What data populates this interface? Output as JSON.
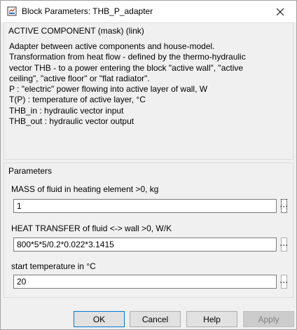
{
  "window": {
    "title": "Block Parameters: THB_P_adapter"
  },
  "description_group": {
    "title": "ACTIVE COMPONENT (mask) (link)",
    "text": "Adapter between active components and house-model.\nTransformation from heat flow - defined by the thermo-hydraulic\nvector THB - to a power entering the block \"active wall\", \"active\nceiling\", \"active floor\" or \"flat radiator\".\nP  : \"electric\" power flowing into active layer of wall, W\nT(P)  : temperature of active layer, °C\nTHB_in  : hydraulic vector input\nTHB_out : hydraulic vector output"
  },
  "parameters_group": {
    "title": "Parameters",
    "params": [
      {
        "label": "MASS of fluid in heating element >0, kg",
        "value": "1"
      },
      {
        "label": "HEAT TRANSFER of fluid <-> wall >0, W/K",
        "value": "800*5*5/0.2*0.022*3.1415"
      },
      {
        "label": "start temperature in °C",
        "value": "20"
      }
    ]
  },
  "buttons": {
    "ok": "OK",
    "cancel": "Cancel",
    "help": "Help",
    "apply": "Apply"
  },
  "icons": {
    "app": "simulink-block-icon",
    "close": "close-icon",
    "more": "ellipsis-icon"
  }
}
